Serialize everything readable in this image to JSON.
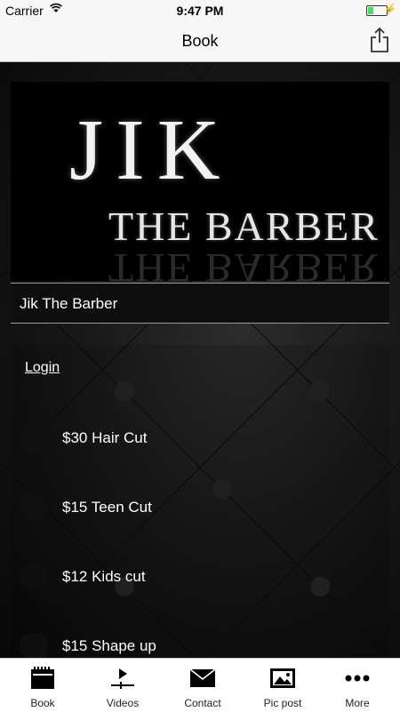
{
  "status_bar": {
    "carrier": "Carrier",
    "time": "9:47 PM"
  },
  "nav": {
    "title": "Book"
  },
  "banner": {
    "logo_main": "JIK",
    "logo_sub": "THE BARBER"
  },
  "business_name": "Jik The Barber",
  "login_label": "Login",
  "services": [
    {
      "label": "$30 Hair Cut"
    },
    {
      "label": "$15 Teen Cut"
    },
    {
      "label": "$12 Kids cut"
    },
    {
      "label": "$15 Shape up"
    }
  ],
  "tabs": [
    {
      "label": "Book",
      "icon": "calendar-icon"
    },
    {
      "label": "Videos",
      "icon": "video-play-icon"
    },
    {
      "label": "Contact",
      "icon": "envelope-icon"
    },
    {
      "label": "Pic post",
      "icon": "picture-icon"
    },
    {
      "label": "More",
      "icon": "more-dots-icon"
    }
  ],
  "colors": {
    "battery": "#4cd964",
    "text_on_dark": "#ffffff"
  }
}
